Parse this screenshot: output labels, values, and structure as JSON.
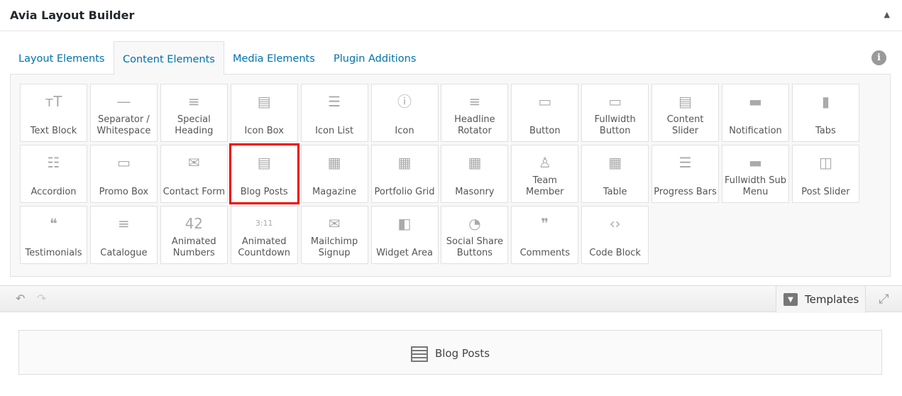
{
  "header": {
    "title": "Avia Layout Builder",
    "toggle": "▲"
  },
  "tabs": [
    {
      "label": "Layout Elements"
    },
    {
      "label": "Content Elements"
    },
    {
      "label": "Media Elements"
    },
    {
      "label": "Plugin Additions"
    }
  ],
  "info_icon": "i",
  "elements": [
    {
      "label": "Text Block",
      "icon": "тT"
    },
    {
      "label": "Separator / Whitespace",
      "icon": "—"
    },
    {
      "label": "Special Heading",
      "icon": "≡"
    },
    {
      "label": "Icon Box",
      "icon": "▤"
    },
    {
      "label": "Icon List",
      "icon": "☰"
    },
    {
      "label": "Icon",
      "icon": "ⓘ"
    },
    {
      "label": "Headline Rotator",
      "icon": "≡"
    },
    {
      "label": "Button",
      "icon": "▭"
    },
    {
      "label": "Fullwidth Button",
      "icon": "▭"
    },
    {
      "label": "Content Slider",
      "icon": "▤"
    },
    {
      "label": "Notification",
      "icon": "▬"
    },
    {
      "label": "Tabs",
      "icon": "▮"
    },
    {
      "label": "Accordion",
      "icon": "☷"
    },
    {
      "label": "Promo Box",
      "icon": "▭"
    },
    {
      "label": "Contact Form",
      "icon": "✉"
    },
    {
      "label": "Blog Posts",
      "icon": "▤",
      "selected": true
    },
    {
      "label": "Magazine",
      "icon": "▦"
    },
    {
      "label": "Portfolio Grid",
      "icon": "▦"
    },
    {
      "label": "Masonry",
      "icon": "▦"
    },
    {
      "label": "Team Member",
      "icon": "♙"
    },
    {
      "label": "Table",
      "icon": "▦"
    },
    {
      "label": "Progress Bars",
      "icon": "☰"
    },
    {
      "label": "Fullwidth Sub Menu",
      "icon": "▬"
    },
    {
      "label": "Post Slider",
      "icon": "◫"
    },
    {
      "label": "Testimonials",
      "icon": "❝"
    },
    {
      "label": "Catalogue",
      "icon": "≡"
    },
    {
      "label": "Animated Numbers",
      "icon": "42"
    },
    {
      "label": "Animated Countdown",
      "icon": "3:11"
    },
    {
      "label": "Mailchimp Signup",
      "icon": "✉"
    },
    {
      "label": "Widget Area",
      "icon": "◧"
    },
    {
      "label": "Social Share Buttons",
      "icon": "◔"
    },
    {
      "label": "Comments",
      "icon": "❞"
    },
    {
      "label": "Code Block",
      "icon": "‹›"
    }
  ],
  "toolbar": {
    "undo": "↶",
    "redo": "↷",
    "templates_label": "Templates",
    "fullscreen": "⤢"
  },
  "canvas": {
    "element_label": "Blog Posts"
  }
}
